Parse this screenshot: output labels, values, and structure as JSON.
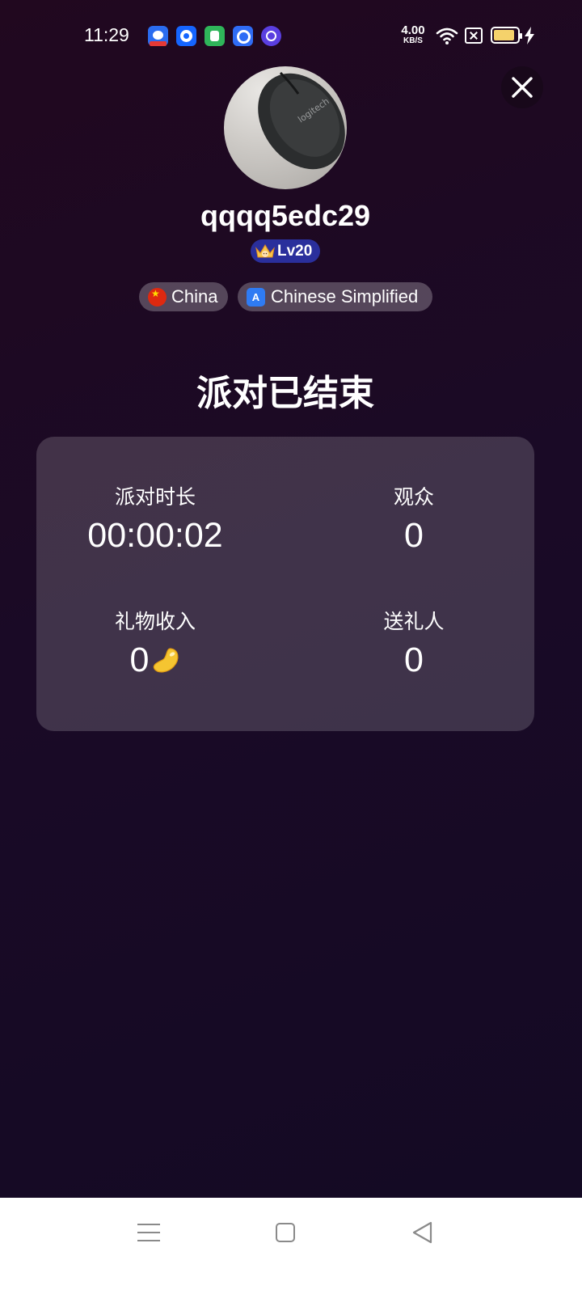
{
  "status_bar": {
    "time": "11:29",
    "net_speed_value": "4.00",
    "net_speed_unit": "KB/S",
    "app_icons": [
      "baidu-app-icon",
      "blue-app-icon",
      "green-app-icon",
      "blue-search-app-icon",
      "purple-app-icon"
    ],
    "battery_level": 0.9,
    "battery_color": "#f5d26b"
  },
  "profile": {
    "username": "qqqq5edc29",
    "level": "Lv20",
    "country": "China",
    "language": "Chinese Simplified"
  },
  "party": {
    "ended_title": "派对已结束",
    "stats": {
      "duration_label": "派对时长",
      "duration_value": "00:00:02",
      "audience_label": "观众",
      "audience_value": "0",
      "gift_income_label": "礼物收入",
      "gift_income_value": "0",
      "gift_givers_label": "送礼人",
      "gift_givers_value": "0"
    }
  },
  "colors": {
    "background_top": "#21081f",
    "background_bottom": "#130a24",
    "level_badge": "#2a2f9c",
    "card": "rgba(255,255,255,0.17)"
  }
}
